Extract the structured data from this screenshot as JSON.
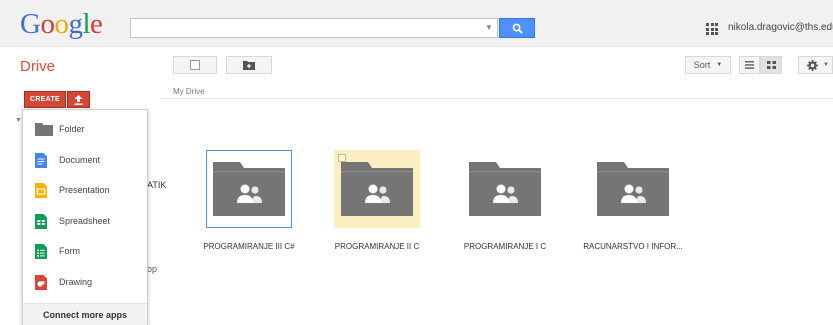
{
  "header": {
    "logo": [
      "G",
      "o",
      "o",
      "g",
      "l",
      "e"
    ],
    "search_placeholder": "",
    "account_email": "nikola.dragovic@ths.edu.rs"
  },
  "toolbar": {
    "app_title": "Drive",
    "sort_label": "Sort",
    "breadcrumb": "My Drive"
  },
  "create": {
    "button_label": "CREATE",
    "menu_items": [
      {
        "label": "Folder",
        "icon": "folder-icon",
        "color": "#757575"
      },
      {
        "label": "Document",
        "icon": "document-icon",
        "color": "#4285f4"
      },
      {
        "label": "Presentation",
        "icon": "presentation-icon",
        "color": "#f4b400"
      },
      {
        "label": "Spreadsheet",
        "icon": "spreadsheet-icon",
        "color": "#0f9d58"
      },
      {
        "label": "Form",
        "icon": "form-icon",
        "color": "#0f9d58"
      },
      {
        "label": "Drawing",
        "icon": "drawing-icon",
        "color": "#db4437"
      }
    ],
    "connect_more_apps": "Connect more apps"
  },
  "nav_fragments": [
    "ATIK",
    "op"
  ],
  "folders": [
    {
      "title": "PROGRAMIRANJE III C#",
      "state": "selected"
    },
    {
      "title": "PROGRAMIRANJE II C",
      "state": "highlighted"
    },
    {
      "title": "PROGRAMIRANJE I C",
      "state": "normal"
    },
    {
      "title": "RACUNARSTVO I INFOR...",
      "state": "normal"
    }
  ],
  "colors": {
    "accent_red": "#d14836",
    "search_blue": "#4d90fe",
    "folder_gray": "#757575",
    "highlight_yellow": "#fbeec0"
  }
}
